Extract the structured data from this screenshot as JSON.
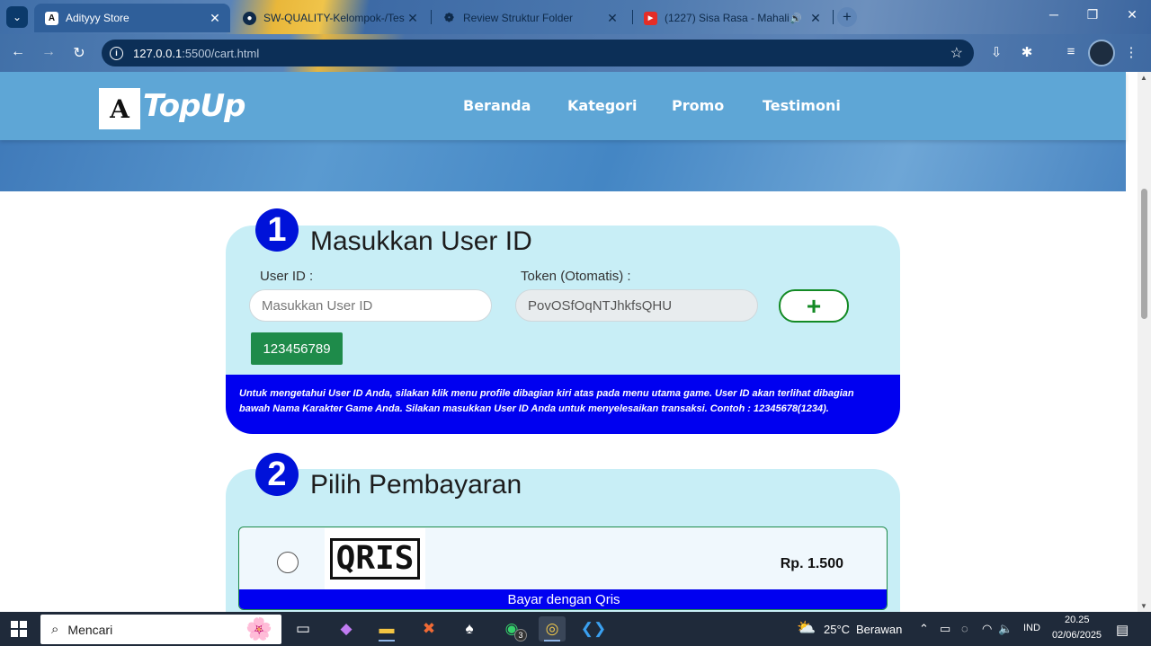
{
  "browser": {
    "tabs": [
      {
        "title": "Adityyy Store",
        "favicon": "A",
        "active": true
      },
      {
        "title": "SW-QUALITY-Kelompok-/Tests",
        "favicon": "github-icon",
        "active": false
      },
      {
        "title": "Review Struktur Folder",
        "favicon": "chatgpt-icon",
        "active": false
      },
      {
        "title": "(1227) Sisa Rasa - Mahalini",
        "favicon": "youtube-icon",
        "active": false
      }
    ],
    "url_host": "127.0.0.1",
    "url_rest": ":5500/cart.html"
  },
  "site": {
    "logo_letter": "A",
    "logo_text": "TopUp",
    "nav": [
      "Beranda",
      "Kategori",
      "Promo",
      "Testimoni"
    ]
  },
  "step1": {
    "number": "1",
    "title": "Masukkan User ID",
    "user_id_label": "User ID :",
    "user_id_placeholder": "Masukkan User ID",
    "token_label": "Token (Otomatis) :",
    "token_value": "PovOSfOqNTJhkfsQHU",
    "add_button": "+",
    "saved_id": "123456789",
    "info_text": "Untuk mengetahui User ID Anda, silakan klik menu profile dibagian kiri atas pada menu utama game. User ID akan terlihat dibagian bawah Nama Karakter Game Anda. Silakan masukkan User ID Anda untuk menyelesaikan transaksi. Contoh : 12345678(1234)."
  },
  "step2": {
    "number": "2",
    "title": "Pilih Pembayaran",
    "option": {
      "logo_text": "QRIS",
      "price": "Rp. 1.500",
      "label": "Bayar dengan Qris"
    }
  },
  "taskbar": {
    "search_text": "Mencari",
    "whatsapp_badge": "3",
    "weather": "25°C",
    "weather_desc": "Berawan",
    "lang": "IND",
    "time": "20.25",
    "date": "02/06/2025"
  },
  "colors": {
    "primary_blue": "#0000f0",
    "card_bg": "#c8eef6",
    "navbar": "#5ea6d6",
    "green": "#1e8b4a"
  }
}
